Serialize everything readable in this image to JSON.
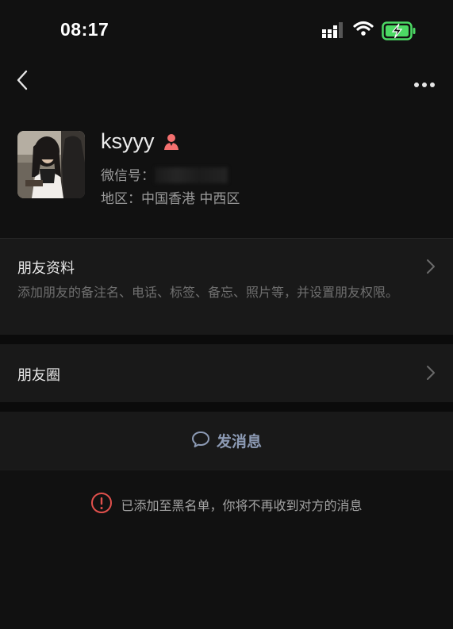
{
  "status_bar": {
    "time": "08:17",
    "icons": [
      "signal-icon",
      "wifi-icon",
      "battery-charging-icon"
    ],
    "battery_color": "#4cd964"
  },
  "nav": {
    "back_icon": "chevron-left-icon",
    "more_icon": "ellipsis-icon"
  },
  "profile": {
    "name": "ksyyy",
    "gender_icon": "female-icon",
    "gender_color": "#f4706f",
    "wechat_id_label": "微信号：",
    "region": "地区：中国香港 中西区"
  },
  "friend_info": {
    "title": "朋友资料",
    "description": "添加朋友的备注名、电话、标签、备忘、照片等，并设置朋友权限。"
  },
  "moments": {
    "title": "朋友圈"
  },
  "send_message": {
    "label": "发消息",
    "icon": "chat-bubble-icon",
    "color": "#8d9bb5"
  },
  "notice": {
    "icon": "warning-circle-icon",
    "icon_color": "#e0504c",
    "text": "已添加至黑名单，你将不再收到对方的消息"
  }
}
